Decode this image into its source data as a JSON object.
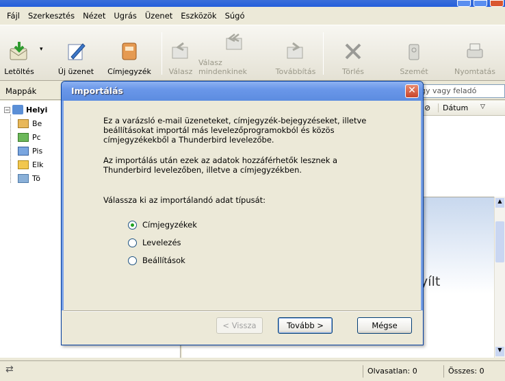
{
  "menu": [
    {
      "label": "Fájl"
    },
    {
      "label": "Szerkesztés"
    },
    {
      "label": "Nézet"
    },
    {
      "label": "Ugrás"
    },
    {
      "label": "Üzenet"
    },
    {
      "label": "Eszközök"
    },
    {
      "label": "Súgó"
    }
  ],
  "toolbar": {
    "download": "Letöltés",
    "new_message": "Új üzenet",
    "address_book": "Címjegyzék",
    "reply": "Válasz",
    "reply_all": "Válasz mindenkinek",
    "forward": "Továbbítás",
    "delete": "Törlés",
    "junk": "Szemét",
    "print": "Nyomtatás"
  },
  "folderbar": {
    "label": "Mappák",
    "search_value": "gy vagy feladó"
  },
  "folders": {
    "root": "Helyi",
    "items": [
      "Be",
      "Pc",
      "Pis",
      "Elk",
      "Tö"
    ]
  },
  "columns": {
    "date": "Dátum"
  },
  "preview_text": "nyílt",
  "status": {
    "unread": "Olvasatlan: 0",
    "total": "Összes: 0"
  },
  "dialog": {
    "title": "Importálás",
    "close": "✕",
    "para1": "Ez a varázsló e-mail üzeneteket, címjegyzék-bejegyzéseket, illetve beállításokat importál más levelezőprogramokból és közös címjegyzékekből a Thunderbird levelezőbe.",
    "para2": "Az importálás után ezek az adatok hozzáférhetők lesznek a Thunderbird levelezőben, illetve a címjegyzékben.",
    "prompt": "Válassza ki az importálandó adat típusát:",
    "options": [
      {
        "label": "Címjegyzékek",
        "selected": true
      },
      {
        "label": "Levelezés",
        "selected": false
      },
      {
        "label": "Beállítások",
        "selected": false
      }
    ],
    "back": "< Vissza",
    "next": "Tovább >",
    "cancel": "Mégse"
  }
}
